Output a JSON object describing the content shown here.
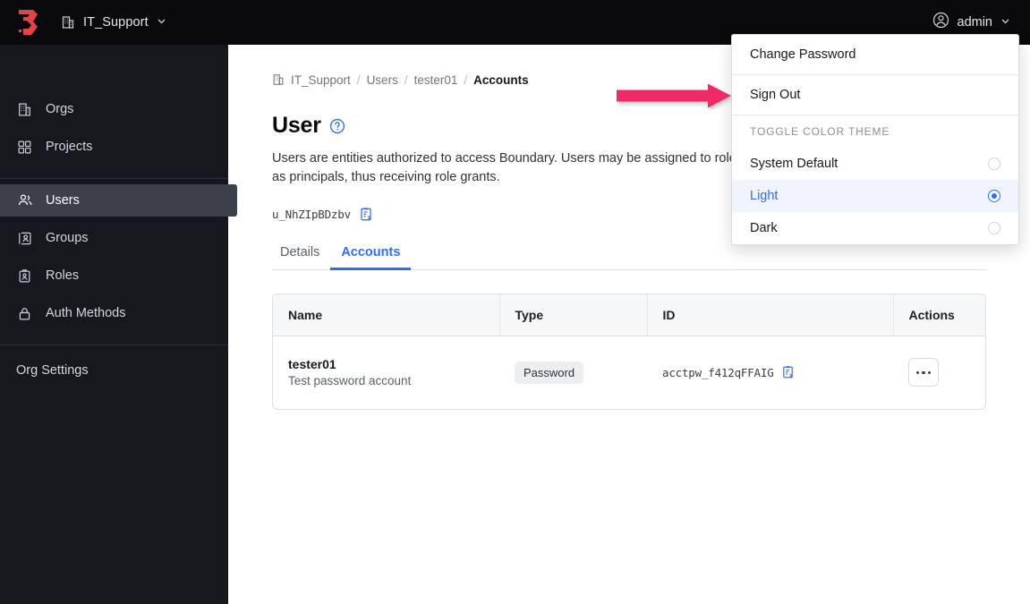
{
  "topbar": {
    "logo_name": "boundary-logo",
    "org_icon": "building-icon",
    "org_label": "IT_Support",
    "org_chevron": "chevron-down-icon",
    "user_icon": "user-circle-icon",
    "user_label": "admin",
    "user_chevron": "chevron-down-icon",
    "brand_color": "#E4434B"
  },
  "sidebar": {
    "items": [
      {
        "label": "Orgs",
        "icon": "building-icon",
        "active": false
      },
      {
        "label": "Projects",
        "icon": "grid-icon",
        "active": false
      },
      {
        "label": "Users",
        "icon": "users-icon",
        "active": true
      },
      {
        "label": "Groups",
        "icon": "group-card-icon",
        "active": false
      },
      {
        "label": "Roles",
        "icon": "id-badge-icon",
        "active": false
      },
      {
        "label": "Auth Methods",
        "icon": "lock-icon",
        "active": false
      }
    ],
    "settings_label": "Org Settings"
  },
  "breadcrumb": {
    "icon": "building-icon",
    "items": [
      "IT_Support",
      "Users",
      "tester01",
      "Accounts"
    ],
    "separator": "/"
  },
  "page": {
    "title": "User",
    "help_icon": "question-circle-icon",
    "description": "Users are entities authorized to access Boundary. Users may be assigned to roles as principals, thus receiving role grants.",
    "resource_id": "u_NhZIpBDzbv",
    "copy_icon": "copy-clipboard-icon"
  },
  "tabs": [
    {
      "label": "Details",
      "active": false
    },
    {
      "label": "Accounts",
      "active": true
    }
  ],
  "table": {
    "columns": [
      "Name",
      "Type",
      "ID",
      "Actions"
    ],
    "rows": [
      {
        "name": "tester01",
        "description": "Test password account",
        "type": "Password",
        "id": "acctpw_f412qFFAIG",
        "copy_icon": "copy-clipboard-icon",
        "actions_icon": "ellipsis-icon"
      }
    ]
  },
  "user_menu": {
    "items": [
      {
        "label": "Change Password"
      },
      {
        "label": "Sign Out"
      }
    ],
    "theme_section_label": "TOGGLE COLOR THEME",
    "theme_options": [
      {
        "label": "System Default",
        "selected": false
      },
      {
        "label": "Light",
        "selected": true
      },
      {
        "label": "Dark",
        "selected": false
      }
    ]
  },
  "annotation": {
    "arrow_name": "sign-out-pointer-arrow",
    "color": "#F02C66"
  }
}
